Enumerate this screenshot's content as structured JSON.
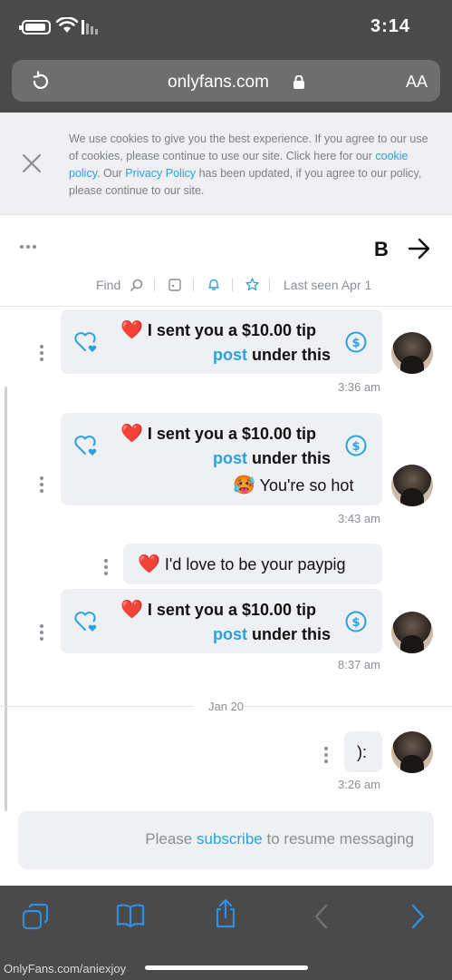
{
  "status_bar": {
    "time": "3:14"
  },
  "browser": {
    "url": "onlyfans.com",
    "text_size_button": "AA"
  },
  "cookie_banner": {
    "text_part1": "We use cookies to give you the best experience. If you agree to our use of cookies, please continue to use our site. Click here for our ",
    "cookie_policy_link": "cookie policy",
    "text_part2": ". Our ",
    "privacy_policy_link": "Privacy Policy",
    "text_part3": " has been updated, if you agree to our policy, please continue to our site."
  },
  "chat_header": {
    "name": "B",
    "last_seen": "Last seen Apr 1",
    "find_label": "Find"
  },
  "messages": [
    {
      "text": "I sent you a $10.00 tip",
      "emoji": "❤️",
      "link_prefix": "under this ",
      "link": "post",
      "time": "3:36 am"
    },
    {
      "text": "I sent you a $10.00 tip",
      "emoji": "❤️",
      "link_prefix": "under this ",
      "link": "post",
      "extra_text": "You're so hot",
      "extra_emoji": "🥵",
      "time": "3:43 am"
    },
    {
      "own_text": "I'd love to be your paypig",
      "own_emoji": "❤️"
    },
    {
      "text": "I sent you a $10.00 tip",
      "emoji": "❤️",
      "link_prefix": "under this ",
      "link": "post",
      "time": "8:37 am"
    },
    {
      "text": "):",
      "time": "3:26 am"
    }
  ],
  "date_separator": "Jan 20",
  "resume_bar": {
    "prefix": "Please ",
    "link": "subscribe",
    "suffix": " to resume messaging"
  },
  "watermark": "OnlyFans.com/aniexjoy",
  "colors": {
    "link": "#2aa2e1",
    "bubble": "#eef0f3",
    "chrome": "#4a4a4a",
    "accent_blue": "#2f8fe6",
    "heart_red": "#e0282f"
  },
  "icons": [
    "battery-icon",
    "wifi-icon",
    "signal-icon",
    "lock-icon",
    "reload-icon",
    "close-icon",
    "back-arrow-icon",
    "more-dots-icon",
    "search-icon",
    "image-icon",
    "bell-icon",
    "star-icon",
    "dollar-icon",
    "tip-heart-icon",
    "kebab-icon",
    "tabs-icon",
    "bookmarks-icon",
    "share-icon",
    "back-icon",
    "forward-icon"
  ]
}
